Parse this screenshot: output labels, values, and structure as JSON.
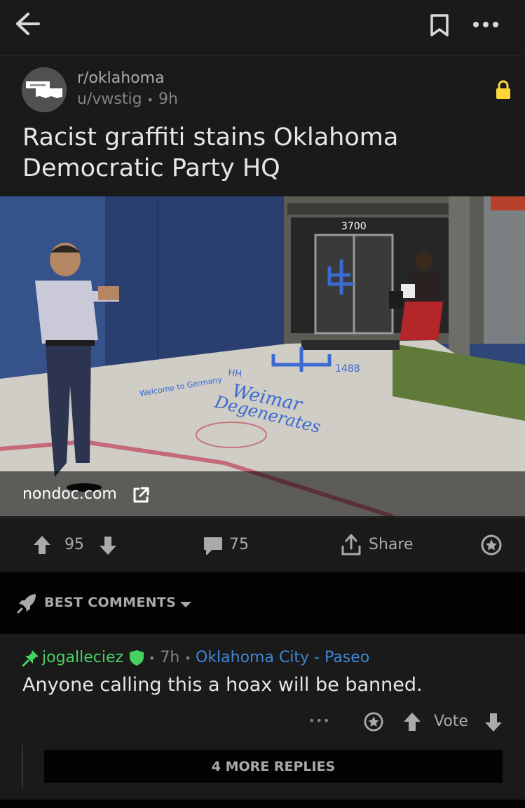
{
  "post": {
    "subreddit": "r/oklahoma",
    "author": "u/vwstig",
    "separator": "•",
    "age": "9h",
    "title": "Racist graffiti stains Oklahoma Democratic Party HQ",
    "link_domain": "nondoc.com",
    "image_texts": {
      "address": "3700",
      "n1488": "1488",
      "hh": "HH",
      "welcome": "Welcome to Germany",
      "weimar": "Weimar",
      "degenerates": "Degenerates"
    }
  },
  "actions": {
    "upvotes": "95",
    "comments": "75",
    "share": "Share"
  },
  "sort": {
    "label": "BEST COMMENTS"
  },
  "comment": {
    "author": "jogalleciez",
    "separator": "•",
    "age": "7h",
    "flair": "Oklahoma City - Paseo",
    "body": "Anyone calling this a hoax will be banned.",
    "more": "•••",
    "vote_label": "Vote",
    "more_replies": "4 MORE REPLIES"
  },
  "colors": {
    "background": "#1a1a1b",
    "lock": "#ffd635",
    "mod_green": "#46d160",
    "flair_blue": "#3d86d4"
  },
  "icons": [
    "back-arrow-icon",
    "bookmark-icon",
    "more-icon",
    "lock-icon",
    "external-link-icon",
    "upvote-icon",
    "downvote-icon",
    "comment-icon",
    "share-icon",
    "award-icon",
    "rocket-icon",
    "chevron-down-icon",
    "pin-icon",
    "shield-icon"
  ]
}
